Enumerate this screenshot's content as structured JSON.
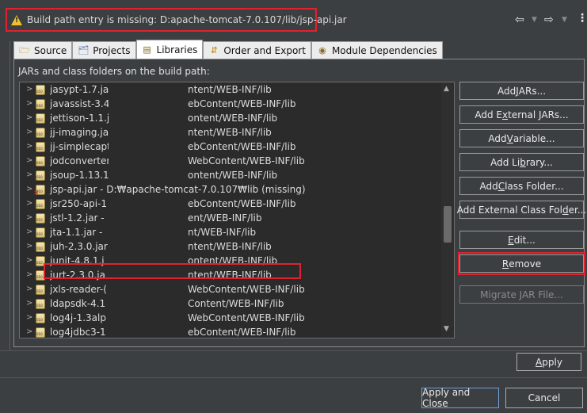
{
  "header": {
    "message": "Build path entry is missing: D:apache-tomcat-7.0.107/lib/jsp-api.jar",
    "back_symbol": "⇦",
    "forward_symbol": "⇨",
    "menu_symbol": "⋮"
  },
  "tabs": [
    {
      "label": "Source",
      "icon": "source-folder-icon"
    },
    {
      "label": "Projects",
      "icon": "projects-icon"
    },
    {
      "label": "Libraries",
      "icon": "libraries-icon"
    },
    {
      "label": "Order and Export",
      "icon": "order-export-icon"
    },
    {
      "label": "Module Dependencies",
      "icon": "module-icon"
    }
  ],
  "libraries": {
    "label": "JARs and class folders on the build path:",
    "entries": [
      {
        "name": "jasypt-1.7.jar",
        "path": "ntent/WEB-INF/lib"
      },
      {
        "name": "javassist-3.4.",
        "path": "ebContent/WEB-INF/lib"
      },
      {
        "name": "jettison-1.1.j",
        "path": "ontent/WEB-INF/lib"
      },
      {
        "name": "jj-imaging.ja",
        "path": "ntent/WEB-INF/lib"
      },
      {
        "name": "jj-simplecapt",
        "path": "ebContent/WEB-INF/lib"
      },
      {
        "name": "jodconverter",
        "path": "WebContent/WEB-INF/lib"
      },
      {
        "name": "jsoup-1.13.1",
        "path": "ontent/WEB-INF/lib"
      },
      {
        "name": "jsp-api.jar - D:₩apache-tomcat-7.0.107₩lib (missing)",
        "path": "",
        "missing": true
      },
      {
        "name": "jsr250-api-1",
        "path": "ebContent/WEB-INF/lib"
      },
      {
        "name": "jstl-1.2.jar -",
        "path": "ent/WEB-INF/lib"
      },
      {
        "name": "jta-1.1.jar -",
        "path": "nt/WEB-INF/lib"
      },
      {
        "name": "juh-2.3.0.jar",
        "path": "ntent/WEB-INF/lib"
      },
      {
        "name": "junit-4.8.1.j",
        "path": "ontent/WEB-INF/lib"
      },
      {
        "name": "jurt-2.3.0.ja",
        "path": "ntent/WEB-INF/lib"
      },
      {
        "name": "jxls-reader-(",
        "path": "WebContent/WEB-INF/lib"
      },
      {
        "name": "ldapsdk-4.1",
        "path": "Content/WEB-INF/lib"
      },
      {
        "name": "log4j-1.3alp",
        "path": "WebContent/WEB-INF/lib"
      },
      {
        "name": "log4jdbc3-1",
        "path": "ebContent/WEB-INF/lib"
      }
    ]
  },
  "buttons": {
    "add_jars": [
      "Add ",
      "J",
      "ARs..."
    ],
    "add_external_jars": [
      "Add E",
      "x",
      "ternal JARs..."
    ],
    "add_variable": [
      "Add ",
      "V",
      "ariable..."
    ],
    "add_library": [
      "Add Li",
      "b",
      "rary..."
    ],
    "add_class_folder": [
      "Add ",
      "C",
      "lass Folder..."
    ],
    "add_external_class_folder": [
      "Add External Class Fol",
      "d",
      "er..."
    ],
    "edit": [
      "",
      "E",
      "dit..."
    ],
    "remove": [
      "",
      "R",
      "emove"
    ],
    "migrate_jar": "Migrate JAR File...",
    "apply": [
      "",
      "A",
      "pply"
    ],
    "apply_and_close": "Apply and Close",
    "cancel": "Cancel"
  }
}
